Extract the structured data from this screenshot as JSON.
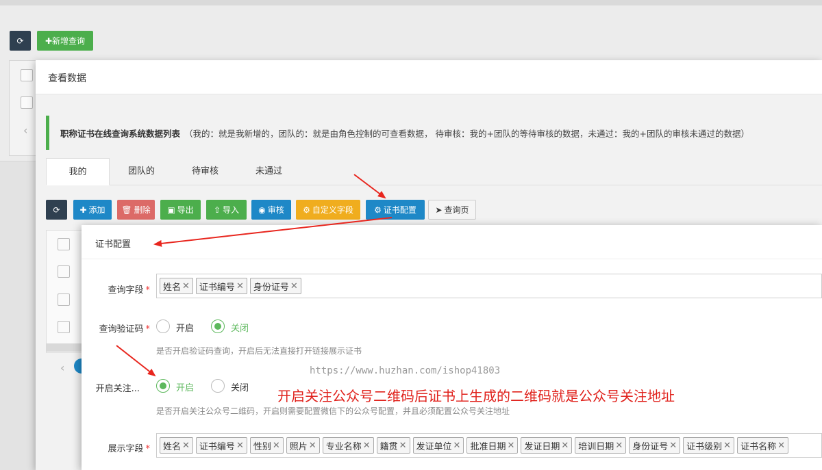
{
  "background": {
    "refresh_icon": "refresh-icon",
    "add_query_label": "新增查询"
  },
  "layer1": {
    "title": "查看数据",
    "notice_title": "职称证书在线查询系统数据列表",
    "notice_desc": "（我的：就是我新增的，团队的：就是由角色控制的可查看数据， 待审核：我的+团队的等待审核的数据，未通过：我的+团队的审核未通过的数据）",
    "tabs": [
      {
        "label": "我的",
        "active": true
      },
      {
        "label": "团队的",
        "active": false
      },
      {
        "label": "待审核",
        "active": false
      },
      {
        "label": "未通过",
        "active": false
      }
    ],
    "toolbar": {
      "add": "添加",
      "delete": "删除",
      "export": "导出",
      "import": "导入",
      "review": "审核",
      "custom_fields": "自定义字段",
      "cert_config": "证书配置",
      "query_page": "查询页"
    },
    "colors": {
      "dark": "#2f4050",
      "blue": "#1e88c7",
      "red": "#d9534f",
      "green": "#4cae4c",
      "orange": "#f0ad1e"
    }
  },
  "layer2": {
    "title": "证书配置",
    "query_fields": {
      "label": "查询字段",
      "tags": [
        "姓名",
        "证书编号",
        "身份证号"
      ]
    },
    "captcha": {
      "label": "查询验证码",
      "options": [
        "开启",
        "关闭"
      ],
      "selected": "关闭",
      "help": "是否开启验证码查询，开启后无法直接打开链接展示证书"
    },
    "follow": {
      "label": "开启关注...",
      "options": [
        "开启",
        "关闭"
      ],
      "selected": "开启",
      "help": "是否开启关注公众号二维码，开启则需要配置微信下的公众号配置，并且必须配置公众号关注地址"
    },
    "display_fields": {
      "label": "展示字段",
      "tags": [
        "姓名",
        "证书编号",
        "性别",
        "照片",
        "专业名称",
        "籍贯",
        "发证单位",
        "批准日期",
        "发证日期",
        "培训日期",
        "身份证号",
        "证书级别",
        "证书名称"
      ]
    }
  },
  "watermark": "https://www.huzhan.com/ishop41803",
  "annotation": "开启关注公众号二维码后证书上生成的二维码就是公众号关注地址",
  "arrow_color": "#e8261e"
}
